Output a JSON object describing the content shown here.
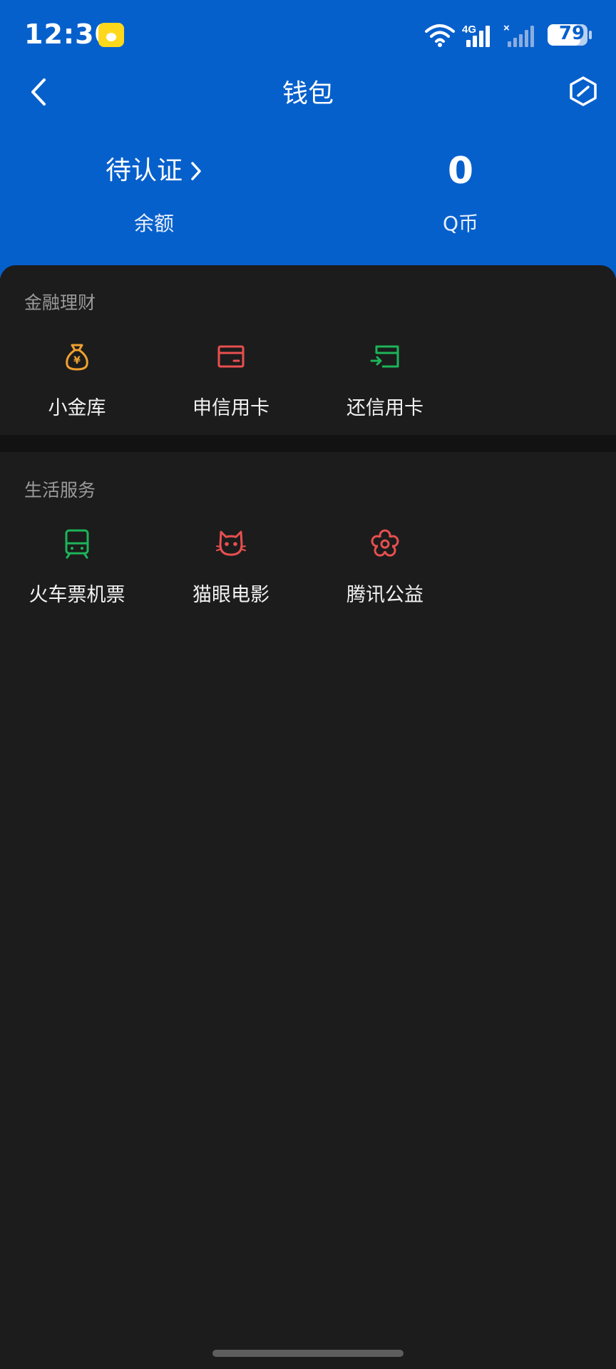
{
  "status_bar": {
    "time": "12:30",
    "network": "4G",
    "battery": "79"
  },
  "nav": {
    "title": "钱包"
  },
  "balance": {
    "status": "待认证",
    "label": "余额"
  },
  "qcoin": {
    "value": "0",
    "label": "Q币"
  },
  "finance": {
    "title": "金融理财",
    "items": [
      {
        "label": "小金库",
        "icon": "money-bag-icon",
        "color": "#f0a030"
      },
      {
        "label": "申信用卡",
        "icon": "credit-card-icon",
        "color": "#e84f4f"
      },
      {
        "label": "还信用卡",
        "icon": "card-repay-icon",
        "color": "#1db458"
      }
    ]
  },
  "life": {
    "title": "生活服务",
    "items": [
      {
        "label": "火车票机票",
        "icon": "train-icon",
        "color": "#1db458"
      },
      {
        "label": "猫眼电影",
        "icon": "cat-icon",
        "color": "#e84f4f"
      },
      {
        "label": "腾讯公益",
        "icon": "flower-icon",
        "color": "#e84f4f"
      }
    ]
  },
  "colors": {
    "header_blue": "#0660cc",
    "background": "#1c1c1c"
  }
}
